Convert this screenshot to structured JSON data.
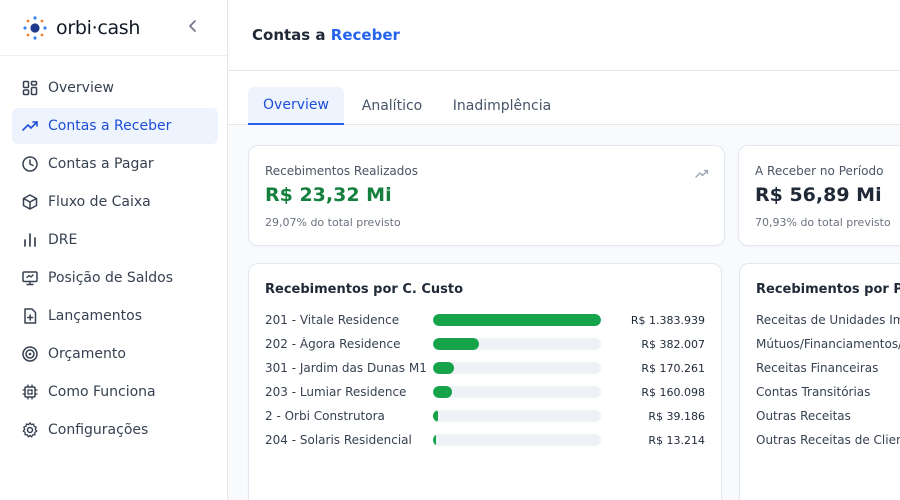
{
  "brand": {
    "name": "orbi·cash"
  },
  "sidebar": {
    "items": [
      {
        "label": "Overview",
        "icon": "grid-icon"
      },
      {
        "label": "Contas a Receber",
        "icon": "trend-up-icon",
        "active": true
      },
      {
        "label": "Contas a Pagar",
        "icon": "clock-icon"
      },
      {
        "label": "Fluxo de Caixa",
        "icon": "box-icon"
      },
      {
        "label": "DRE",
        "icon": "bar-chart-icon"
      },
      {
        "label": "Posição de Saldos",
        "icon": "monitor-icon"
      },
      {
        "label": "Lançamentos",
        "icon": "file-plus-icon"
      },
      {
        "label": "Orçamento",
        "icon": "target-icon"
      },
      {
        "label": "Como Funciona",
        "icon": "cpu-icon"
      },
      {
        "label": "Configurações",
        "icon": "settings-icon"
      }
    ]
  },
  "header": {
    "title_prefix": "Contas a",
    "title_accent": "Receber"
  },
  "tabs": [
    {
      "label": "Overview",
      "active": true
    },
    {
      "label": "Analítico"
    },
    {
      "label": "Inadimplência"
    }
  ],
  "kpis": [
    {
      "label": "Recebimentos Realizados",
      "value": "R$ 23,32 Mi",
      "sub": "29,07% do total previsto",
      "color": "#15803d"
    },
    {
      "label": "A Receber no Período",
      "value": "R$ 56,89 Mi",
      "sub": "70,93% do total previsto",
      "color": "#1f2937"
    }
  ],
  "cost_center": {
    "title": "Recebimentos por C. Custo",
    "bar_color": "#16a34a",
    "max_value": 1383939,
    "rows": [
      {
        "label": "201 - Vitale Residence",
        "amount": 1383939,
        "value_text": "R$ 1.383.939"
      },
      {
        "label": "202 - Ágora Residence",
        "amount": 382007,
        "value_text": "R$ 382.007"
      },
      {
        "label": "301 - Jardim das Dunas M1",
        "amount": 170261,
        "value_text": "R$ 170.261"
      },
      {
        "label": "203 - Lumiar Residence",
        "amount": 160098,
        "value_text": "R$ 160.098"
      },
      {
        "label": "2 - Orbi Construtora",
        "amount": 39186,
        "value_text": "R$ 39.186"
      },
      {
        "label": "204 - Solaris Residencial",
        "amount": 13214,
        "value_text": "R$ 13.214"
      }
    ]
  },
  "plan": {
    "title": "Recebimentos por Pla",
    "rows": [
      "Receitas de Unidades Imo",
      "Mútuos/Financiamentos/C",
      "Receitas Financeiras",
      "Contas Transitórias",
      "Outras Receitas",
      "Outras Receitas de Client"
    ]
  }
}
